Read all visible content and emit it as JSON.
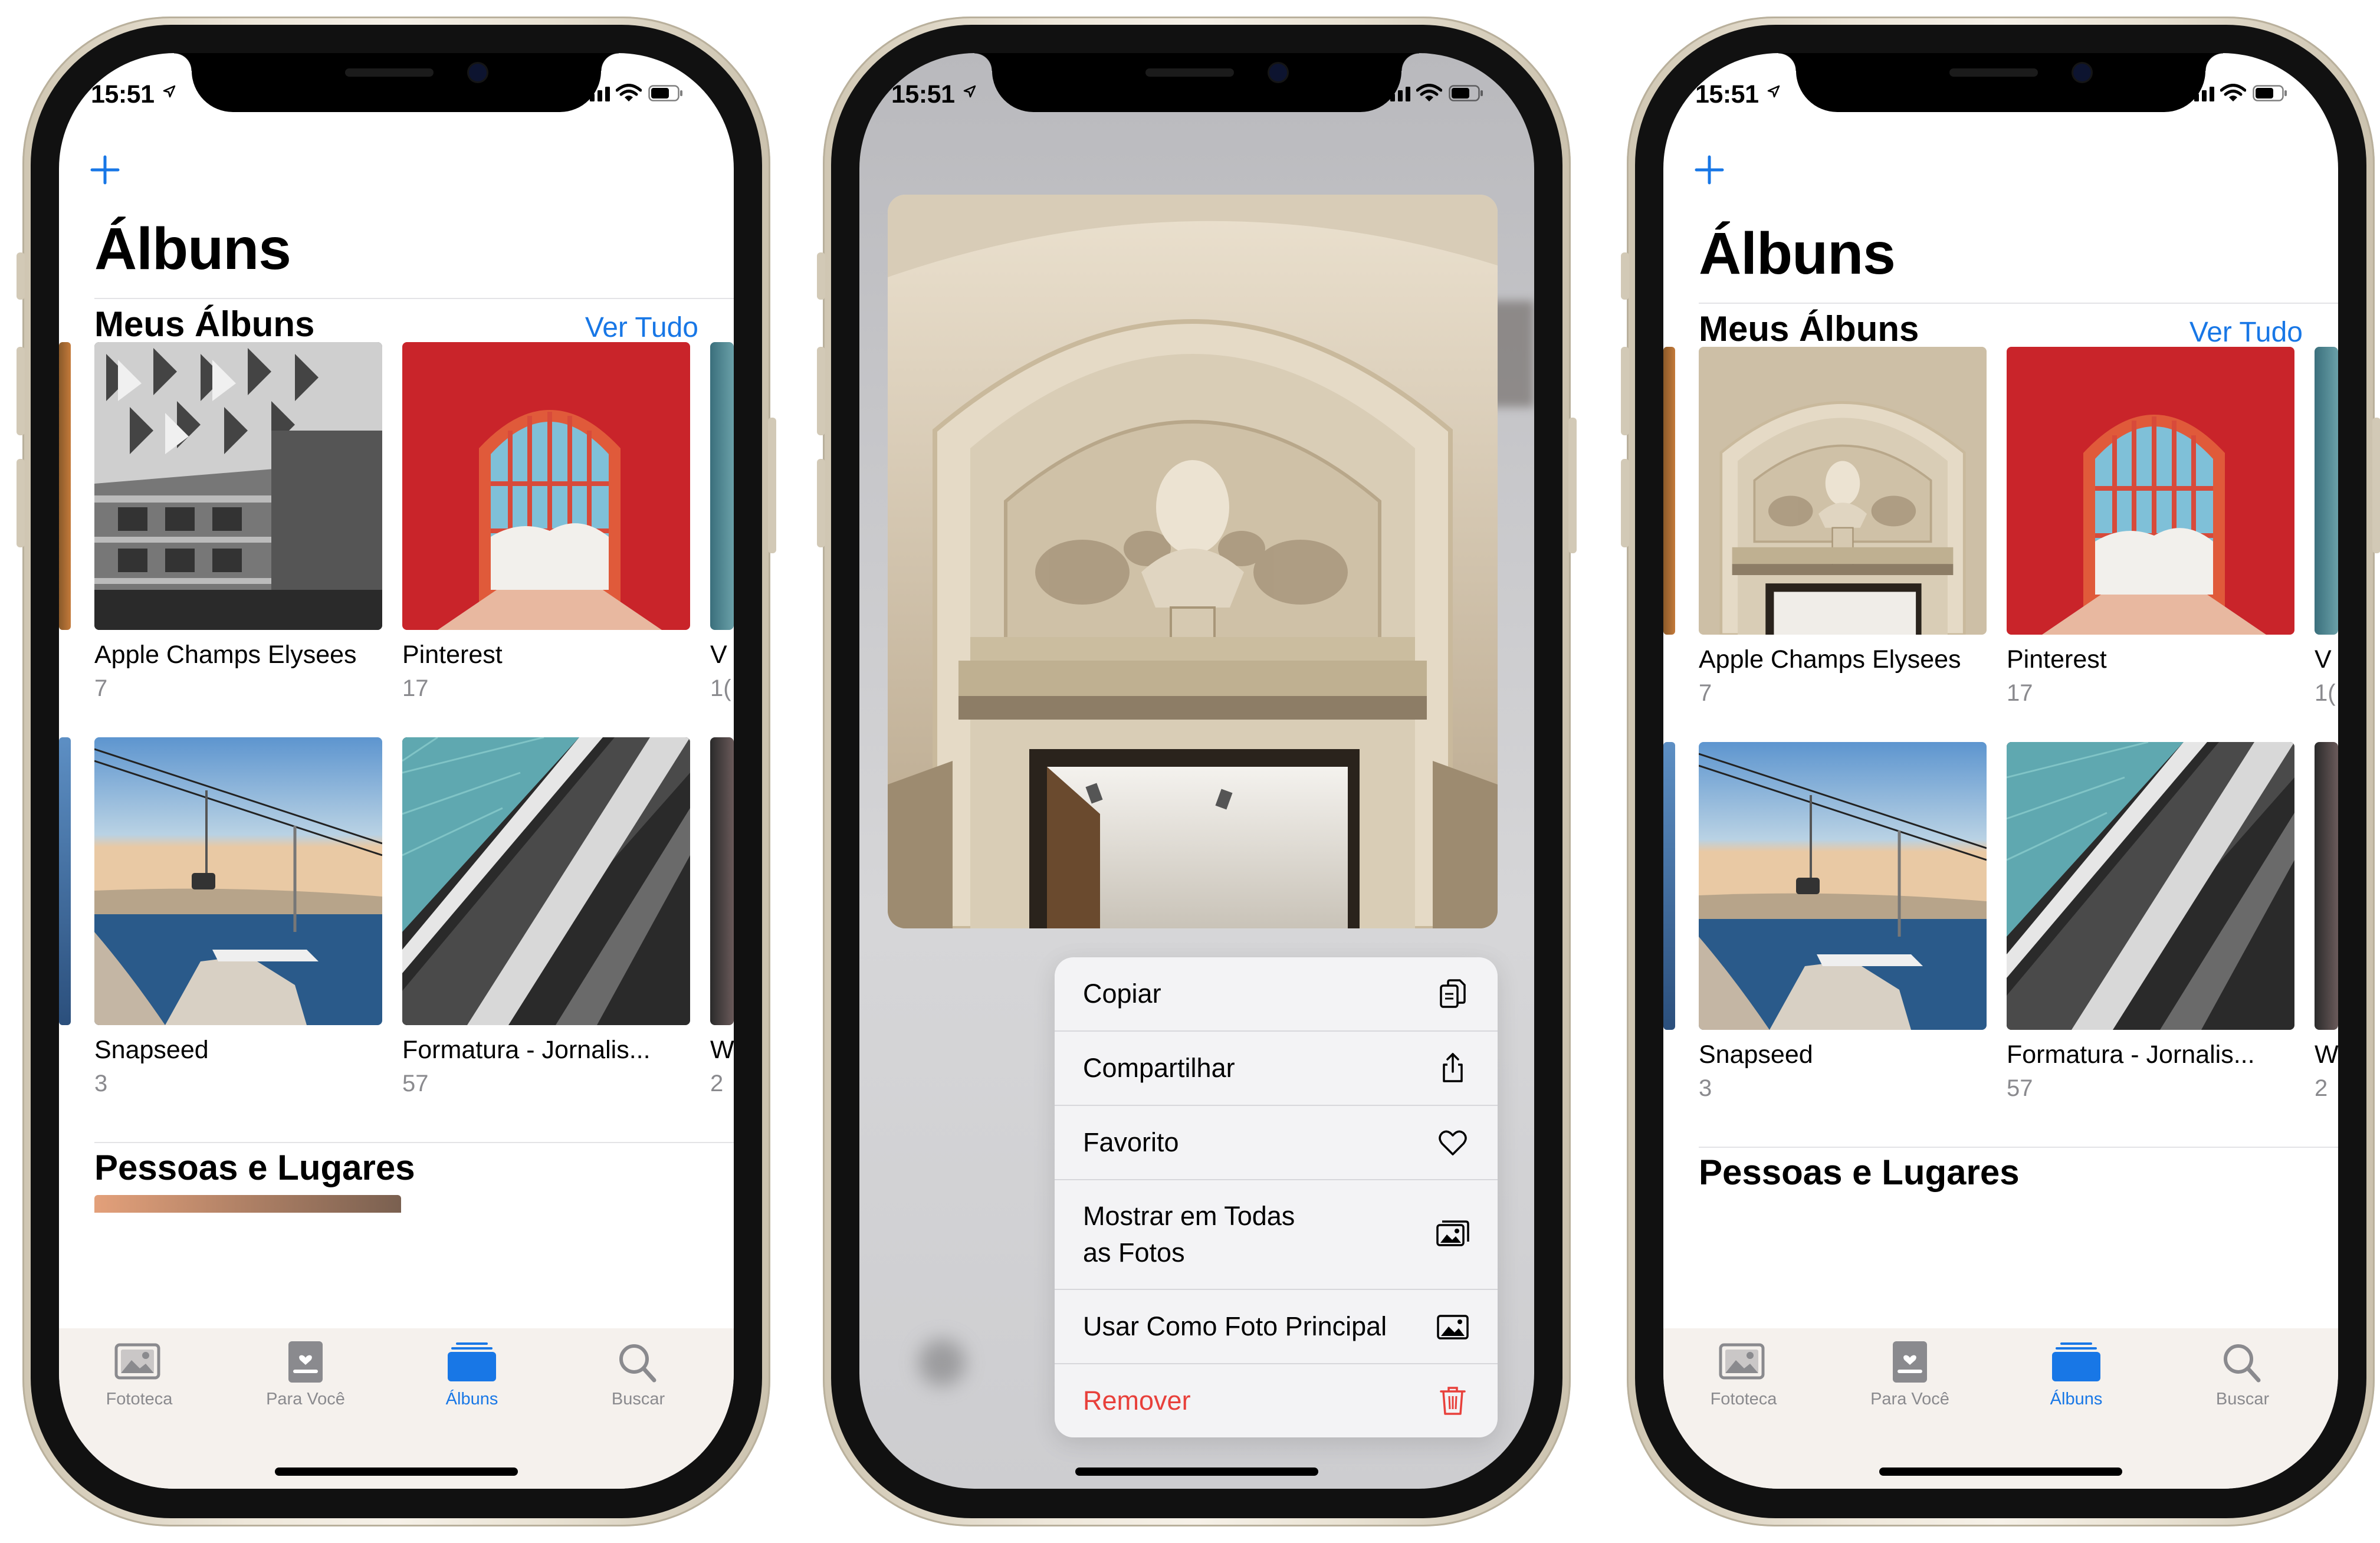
{
  "status": {
    "time": "15:51"
  },
  "albums_screen": {
    "title": "Álbuns",
    "section_my_albums": "Meus Álbuns",
    "see_all": "Ver Tudo",
    "albums": [
      {
        "name": "Apple Champs Elysees",
        "count": "7"
      },
      {
        "name": "Pinterest",
        "count": "17"
      },
      {
        "name": "Snapseed",
        "count": "3"
      },
      {
        "name": "Formatura - Jornalis...",
        "count": "57"
      }
    ],
    "peek_right": [
      {
        "name": "V",
        "count": "1("
      },
      {
        "name": "W",
        "count": "2"
      }
    ],
    "section_people": "Pessoas e Lugares"
  },
  "tabbar": {
    "items": [
      {
        "label": "Fototeca",
        "icon": "photo-library-icon"
      },
      {
        "label": "Para Você",
        "icon": "for-you-icon"
      },
      {
        "label": "Álbuns",
        "icon": "albums-icon",
        "active": true
      },
      {
        "label": "Buscar",
        "icon": "search-icon"
      }
    ],
    "active_color": "#1877e6",
    "inactive_color": "#8a8a8e"
  },
  "context_menu": {
    "items": [
      {
        "label": "Copiar",
        "icon": "copy-icon"
      },
      {
        "label": "Compartilhar",
        "icon": "share-icon"
      },
      {
        "label": "Favorito",
        "icon": "heart-icon"
      },
      {
        "label": "Mostrar em Todas as Fotos",
        "line1": "Mostrar em Todas",
        "line2": "as Fotos",
        "icon": "photos-stack-icon"
      },
      {
        "label": "Usar Como Foto Principal",
        "icon": "photo-icon"
      },
      {
        "label": "Remover",
        "icon": "trash-icon",
        "destructive": true
      }
    ],
    "destructive_color": "#e8403b"
  }
}
